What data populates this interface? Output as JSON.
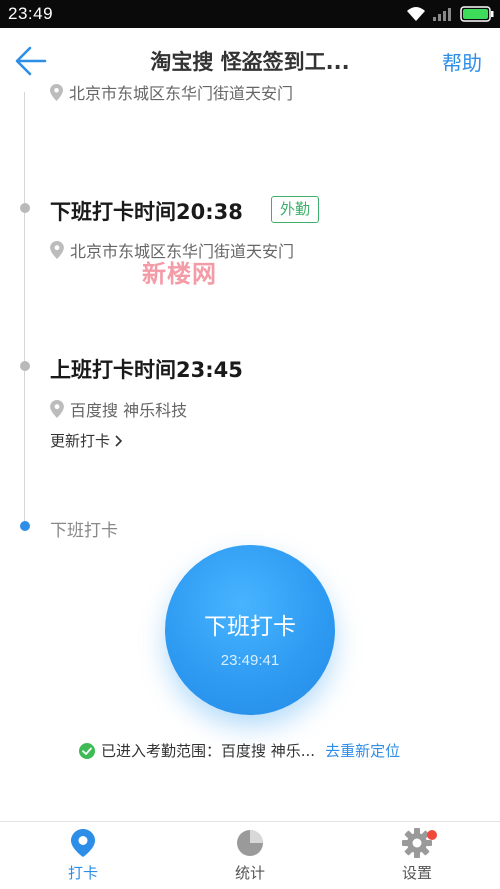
{
  "status_bar": {
    "time": "23:49"
  },
  "header": {
    "title": "淘宝搜 怪盗签到工...",
    "help_label": "帮助"
  },
  "timeline": {
    "partial_location": "北京市东城区东华门街道天安门",
    "records": [
      {
        "title": "下班打卡时间20:38",
        "badge": "外勤",
        "location": "北京市东城区东华门街道天安门"
      },
      {
        "title": "上班打卡时间23:45",
        "location": "百度搜 神乐科技",
        "update_link": "更新打卡"
      }
    ],
    "next_label": "下班打卡"
  },
  "watermark": "新楼网",
  "punch_button": {
    "label": "下班打卡",
    "clock": "23:49:41"
  },
  "range_status": {
    "text": "已进入考勤范围：百度搜 神乐...",
    "relocate_label": "去重新定位"
  },
  "bottom_nav": {
    "items": [
      {
        "label": "打卡",
        "icon": "location-pin-icon",
        "active": true
      },
      {
        "label": "统计",
        "icon": "pie-chart-icon",
        "active": false
      },
      {
        "label": "设置",
        "icon": "gear-icon",
        "active": false
      }
    ]
  },
  "colors": {
    "accent": "#2d8ee8",
    "badge_green": "#3fae6a",
    "notification_red": "#f0493c"
  }
}
